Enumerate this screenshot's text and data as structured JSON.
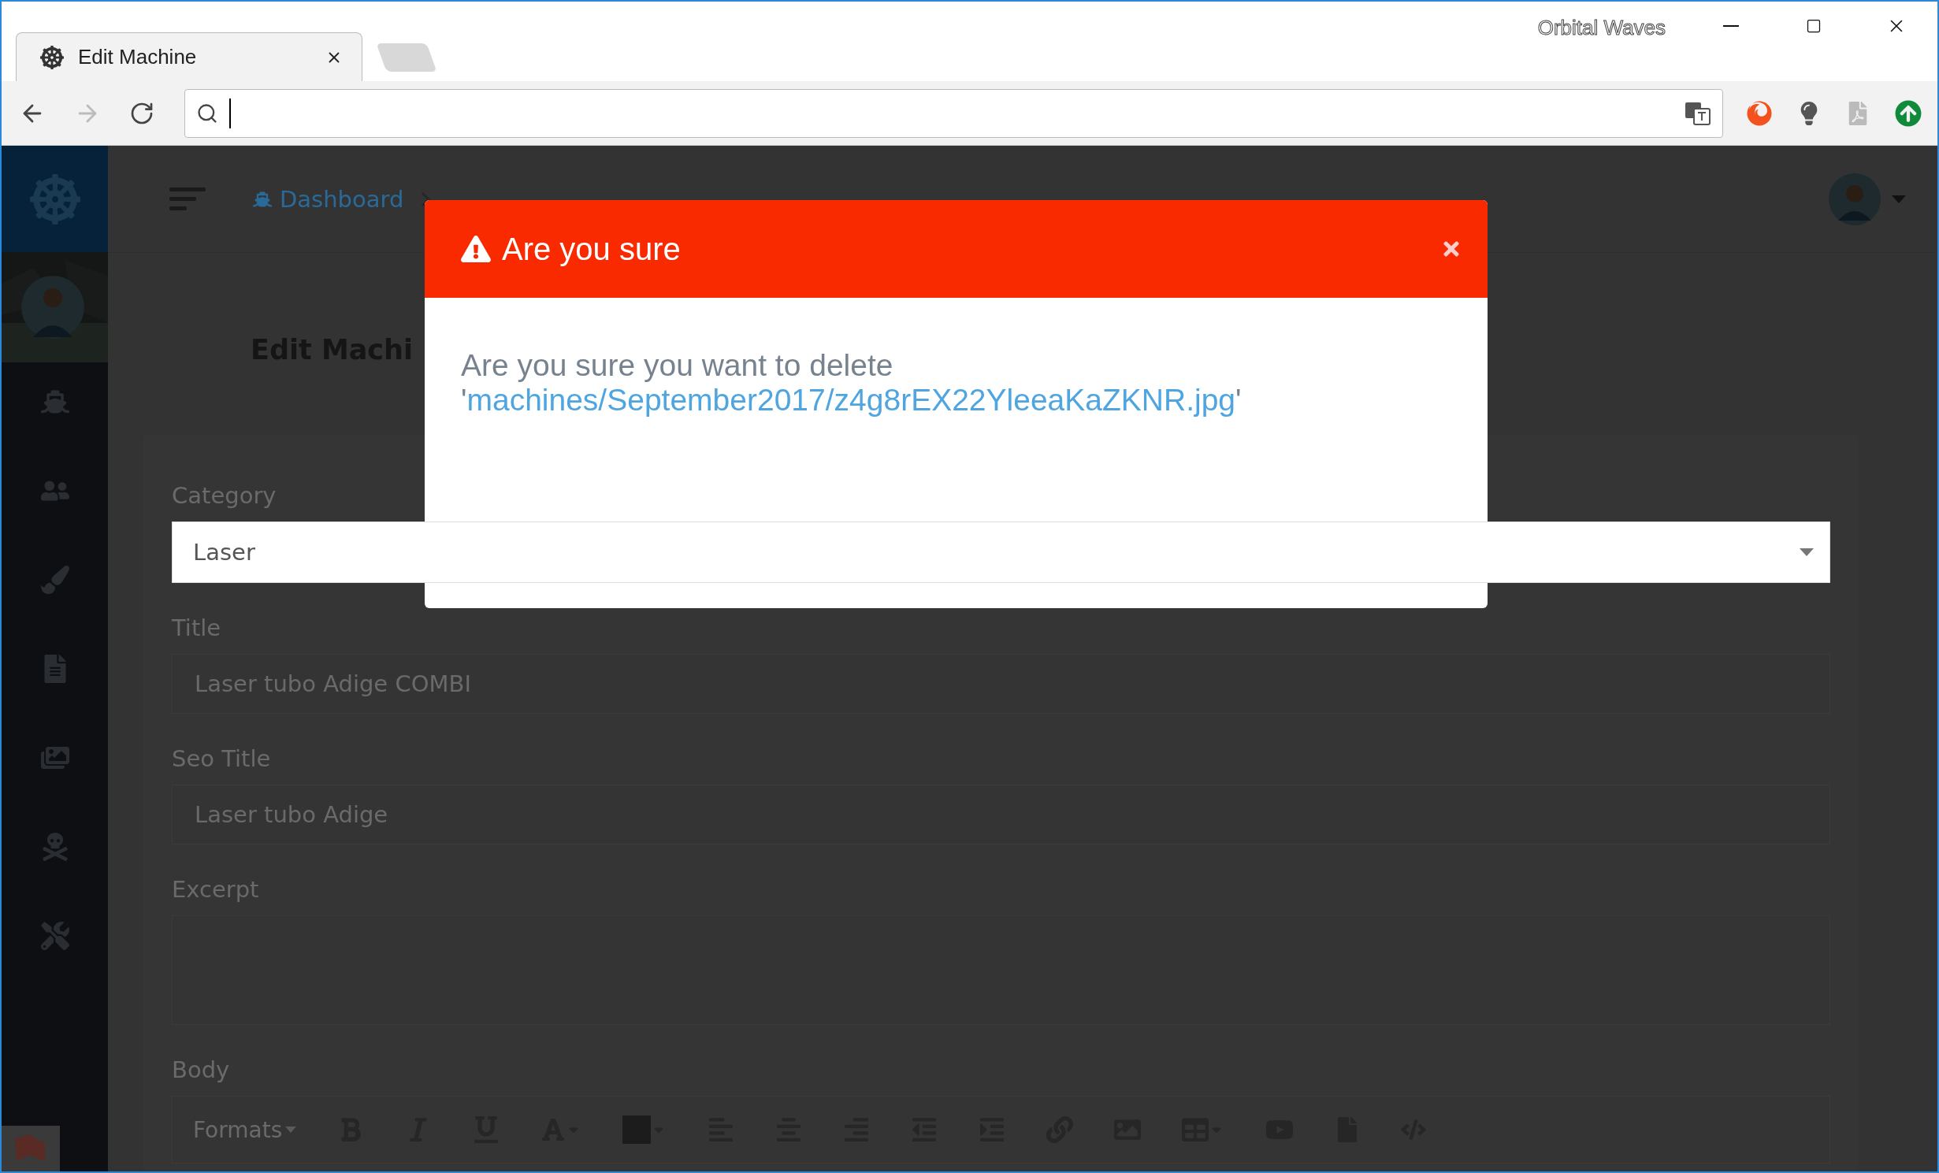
{
  "window": {
    "title": "Orbital Waves"
  },
  "tabs": [
    {
      "label": "Edit Machine",
      "selected": true
    }
  ],
  "address_bar": {
    "focused": true
  },
  "breadcrumb": [
    {
      "label": "Dashboard",
      "kind": "home"
    }
  ],
  "page_title": "Edit Machi",
  "form": {
    "fields": [
      {
        "kind": "select",
        "label": "Category",
        "value": "Laser"
      },
      {
        "kind": "text",
        "label": "Title",
        "value": "Laser tubo Adige COMBI"
      },
      {
        "kind": "text",
        "label": "Seo Title",
        "value": "Laser tubo Adige"
      },
      {
        "kind": "textarea",
        "label": "Excerpt"
      },
      {
        "kind": "editor",
        "label": "Body",
        "formats": "Formats"
      }
    ]
  },
  "modal": {
    "title": "Are you sure",
    "message": "Are you sure you want to delete",
    "quote_open": "'",
    "path": "machines/September2017/z4g8rEX22YleeaKaZKNR.jpg",
    "quote_close": "'"
  }
}
